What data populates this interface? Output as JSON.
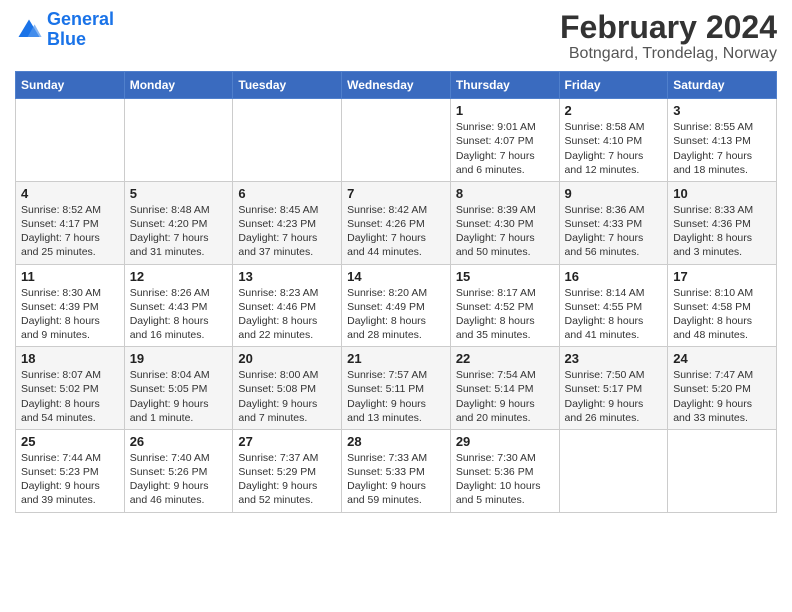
{
  "logo": {
    "line1": "General",
    "line2": "Blue"
  },
  "title": "February 2024",
  "subtitle": "Botngard, Trondelag, Norway",
  "headers": [
    "Sunday",
    "Monday",
    "Tuesday",
    "Wednesday",
    "Thursday",
    "Friday",
    "Saturday"
  ],
  "weeks": [
    [
      {
        "day": "",
        "info": ""
      },
      {
        "day": "",
        "info": ""
      },
      {
        "day": "",
        "info": ""
      },
      {
        "day": "",
        "info": ""
      },
      {
        "day": "1",
        "info": "Sunrise: 9:01 AM\nSunset: 4:07 PM\nDaylight: 7 hours\nand 6 minutes."
      },
      {
        "day": "2",
        "info": "Sunrise: 8:58 AM\nSunset: 4:10 PM\nDaylight: 7 hours\nand 12 minutes."
      },
      {
        "day": "3",
        "info": "Sunrise: 8:55 AM\nSunset: 4:13 PM\nDaylight: 7 hours\nand 18 minutes."
      }
    ],
    [
      {
        "day": "4",
        "info": "Sunrise: 8:52 AM\nSunset: 4:17 PM\nDaylight: 7 hours\nand 25 minutes."
      },
      {
        "day": "5",
        "info": "Sunrise: 8:48 AM\nSunset: 4:20 PM\nDaylight: 7 hours\nand 31 minutes."
      },
      {
        "day": "6",
        "info": "Sunrise: 8:45 AM\nSunset: 4:23 PM\nDaylight: 7 hours\nand 37 minutes."
      },
      {
        "day": "7",
        "info": "Sunrise: 8:42 AM\nSunset: 4:26 PM\nDaylight: 7 hours\nand 44 minutes."
      },
      {
        "day": "8",
        "info": "Sunrise: 8:39 AM\nSunset: 4:30 PM\nDaylight: 7 hours\nand 50 minutes."
      },
      {
        "day": "9",
        "info": "Sunrise: 8:36 AM\nSunset: 4:33 PM\nDaylight: 7 hours\nand 56 minutes."
      },
      {
        "day": "10",
        "info": "Sunrise: 8:33 AM\nSunset: 4:36 PM\nDaylight: 8 hours\nand 3 minutes."
      }
    ],
    [
      {
        "day": "11",
        "info": "Sunrise: 8:30 AM\nSunset: 4:39 PM\nDaylight: 8 hours\nand 9 minutes."
      },
      {
        "day": "12",
        "info": "Sunrise: 8:26 AM\nSunset: 4:43 PM\nDaylight: 8 hours\nand 16 minutes."
      },
      {
        "day": "13",
        "info": "Sunrise: 8:23 AM\nSunset: 4:46 PM\nDaylight: 8 hours\nand 22 minutes."
      },
      {
        "day": "14",
        "info": "Sunrise: 8:20 AM\nSunset: 4:49 PM\nDaylight: 8 hours\nand 28 minutes."
      },
      {
        "day": "15",
        "info": "Sunrise: 8:17 AM\nSunset: 4:52 PM\nDaylight: 8 hours\nand 35 minutes."
      },
      {
        "day": "16",
        "info": "Sunrise: 8:14 AM\nSunset: 4:55 PM\nDaylight: 8 hours\nand 41 minutes."
      },
      {
        "day": "17",
        "info": "Sunrise: 8:10 AM\nSunset: 4:58 PM\nDaylight: 8 hours\nand 48 minutes."
      }
    ],
    [
      {
        "day": "18",
        "info": "Sunrise: 8:07 AM\nSunset: 5:02 PM\nDaylight: 8 hours\nand 54 minutes."
      },
      {
        "day": "19",
        "info": "Sunrise: 8:04 AM\nSunset: 5:05 PM\nDaylight: 9 hours\nand 1 minute."
      },
      {
        "day": "20",
        "info": "Sunrise: 8:00 AM\nSunset: 5:08 PM\nDaylight: 9 hours\nand 7 minutes."
      },
      {
        "day": "21",
        "info": "Sunrise: 7:57 AM\nSunset: 5:11 PM\nDaylight: 9 hours\nand 13 minutes."
      },
      {
        "day": "22",
        "info": "Sunrise: 7:54 AM\nSunset: 5:14 PM\nDaylight: 9 hours\nand 20 minutes."
      },
      {
        "day": "23",
        "info": "Sunrise: 7:50 AM\nSunset: 5:17 PM\nDaylight: 9 hours\nand 26 minutes."
      },
      {
        "day": "24",
        "info": "Sunrise: 7:47 AM\nSunset: 5:20 PM\nDaylight: 9 hours\nand 33 minutes."
      }
    ],
    [
      {
        "day": "25",
        "info": "Sunrise: 7:44 AM\nSunset: 5:23 PM\nDaylight: 9 hours\nand 39 minutes."
      },
      {
        "day": "26",
        "info": "Sunrise: 7:40 AM\nSunset: 5:26 PM\nDaylight: 9 hours\nand 46 minutes."
      },
      {
        "day": "27",
        "info": "Sunrise: 7:37 AM\nSunset: 5:29 PM\nDaylight: 9 hours\nand 52 minutes."
      },
      {
        "day": "28",
        "info": "Sunrise: 7:33 AM\nSunset: 5:33 PM\nDaylight: 9 hours\nand 59 minutes."
      },
      {
        "day": "29",
        "info": "Sunrise: 7:30 AM\nSunset: 5:36 PM\nDaylight: 10 hours\nand 5 minutes."
      },
      {
        "day": "",
        "info": ""
      },
      {
        "day": "",
        "info": ""
      }
    ]
  ]
}
